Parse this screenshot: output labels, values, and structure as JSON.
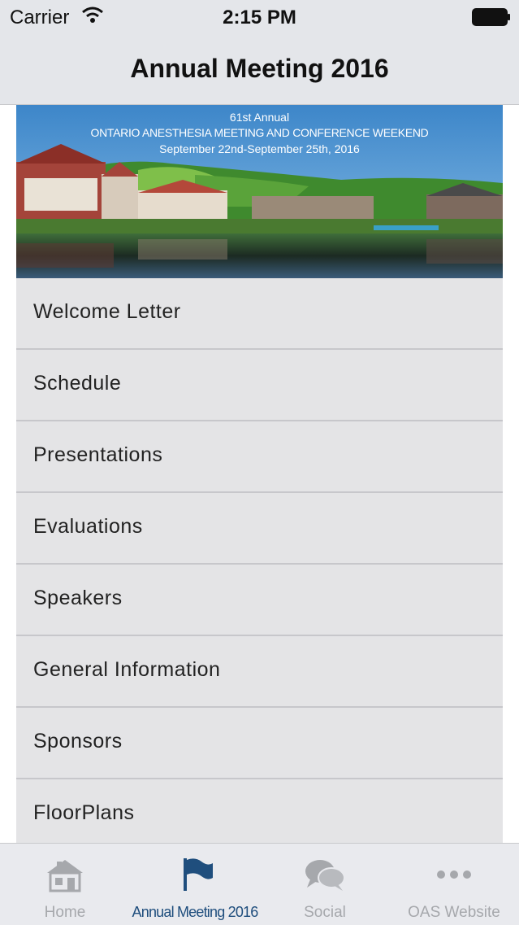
{
  "status_bar": {
    "carrier": "Carrier",
    "time": "2:15 PM"
  },
  "nav": {
    "title": "Annual Meeting 2016"
  },
  "banner": {
    "line1": "61st Annual",
    "line2": "ONTARIO ANESTHESIA MEETING AND CONFERENCE WEEKEND",
    "line3": "September 22nd-September 25th, 2016"
  },
  "menu": {
    "items": [
      {
        "label": "Welcome Letter"
      },
      {
        "label": "Schedule"
      },
      {
        "label": "Presentations"
      },
      {
        "label": "Evaluations"
      },
      {
        "label": "Speakers"
      },
      {
        "label": "General Information"
      },
      {
        "label": "Sponsors"
      },
      {
        "label": "FloorPlans"
      }
    ]
  },
  "tabs": [
    {
      "label": "Home",
      "icon": "house-icon"
    },
    {
      "label": "Annual Meeting 2016",
      "icon": "flag-icon",
      "active": true
    },
    {
      "label": "Social",
      "icon": "chat-bubbles-icon"
    },
    {
      "label": "OAS Website",
      "icon": "more-dots-icon"
    }
  ],
  "colors": {
    "active_tab": "#1f4e7d",
    "inactive_tab": "#a6a8ac",
    "bar_bg": "#e4e6ea",
    "row_bg": "#e4e4e6"
  }
}
